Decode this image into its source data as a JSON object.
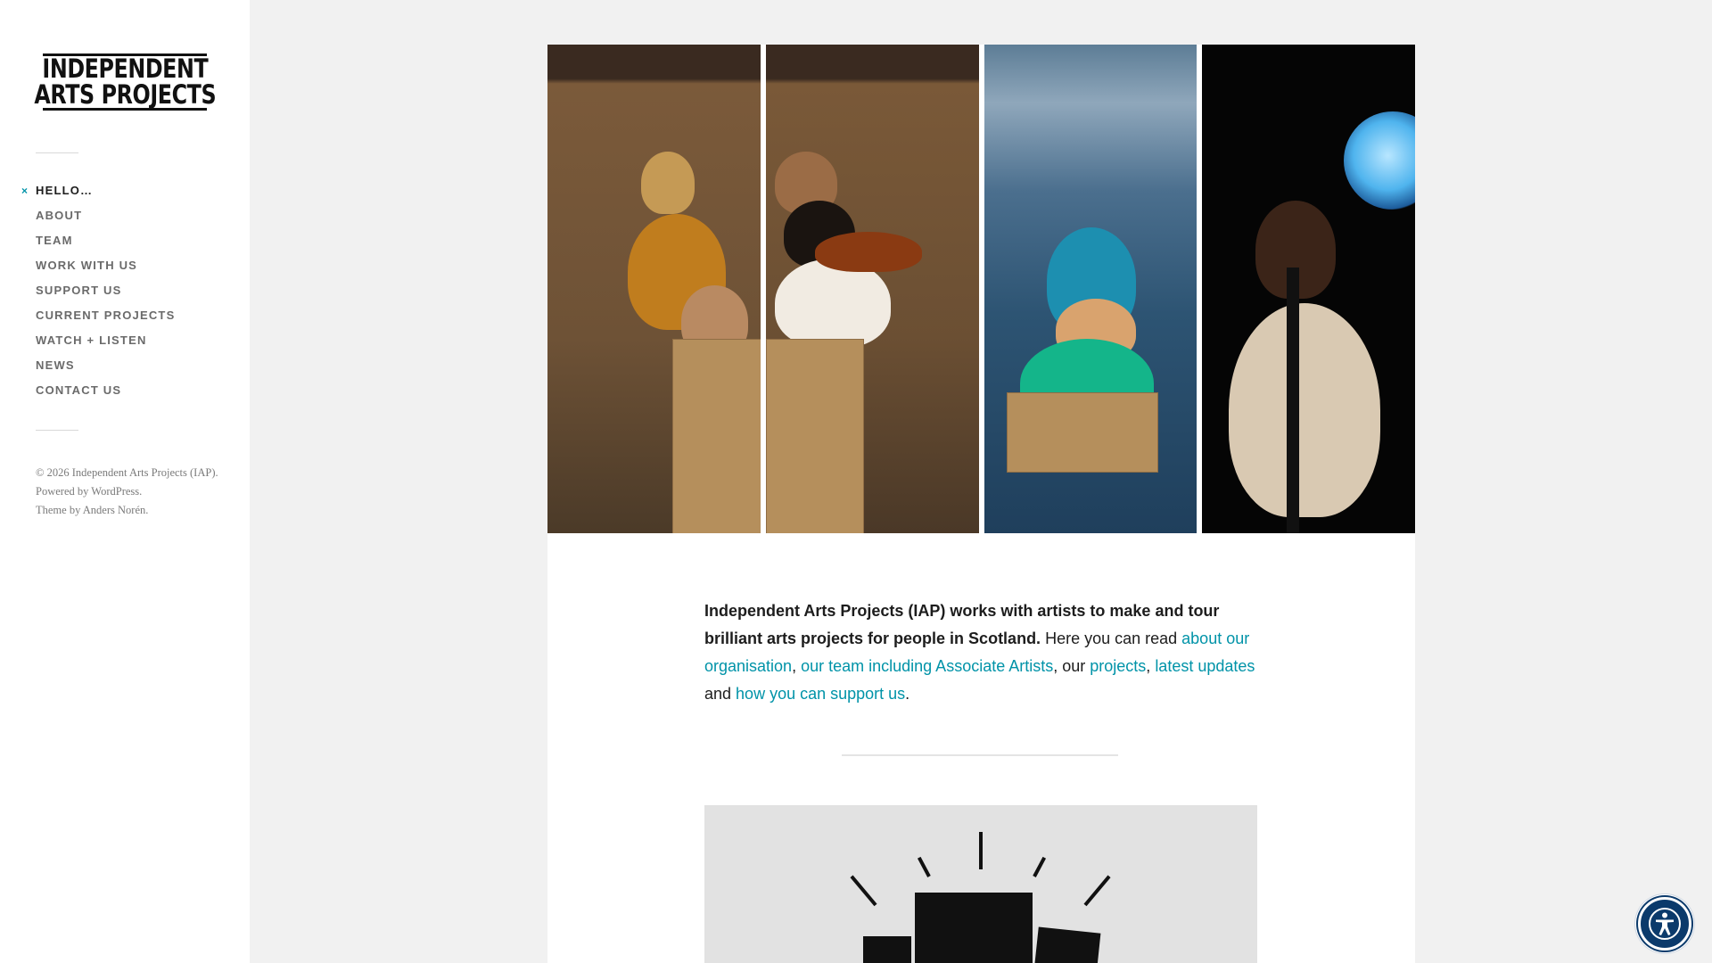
{
  "sidebar": {
    "logo": {
      "line1": "INDEPENDENT",
      "line2": "ARTS PROJECTS"
    },
    "current_marker": "×",
    "nav": [
      {
        "label": "HELLO…",
        "current": true
      },
      {
        "label": "ABOUT",
        "current": false
      },
      {
        "label": "TEAM",
        "current": false
      },
      {
        "label": "WORK WITH US",
        "current": false
      },
      {
        "label": "SUPPORT US",
        "current": false
      },
      {
        "label": "CURRENT PROJECTS",
        "current": false
      },
      {
        "label": "WATCH + LISTEN",
        "current": false
      },
      {
        "label": "NEWS",
        "current": false
      },
      {
        "label": "CONTACT US",
        "current": false
      }
    ],
    "credits": {
      "copyright_prefix": "© 2026",
      "site_name": "Independent Arts Projects (IAP)",
      "period": ".",
      "powered_prefix": "Powered by",
      "powered_link": "WordPress",
      "theme_prefix": "Theme by",
      "theme_link": "Anders Norén"
    }
  },
  "intro": {
    "bold": "Independent Arts Projects (IAP) works with artists to make and tour brilliant arts projects for people in Scotland.",
    "text1": " Here you can read ",
    "link1": "about our organisation",
    "text2": ", ",
    "link2": "our team including Associate Artists",
    "text3": ", our ",
    "link3": "projects",
    "text4": ", ",
    "link4": "latest updates",
    "text5": " and ",
    "link5": "how you can support us",
    "text6": "."
  },
  "colors": {
    "accent_link": "#0093a8",
    "sidebar_bg": "#ffffff",
    "page_bg": "#f1f1f1",
    "a11y_button": "#0b3a6b"
  },
  "icons": {
    "current_marker": "close-icon",
    "accessibility": "accessibility-person-icon"
  }
}
